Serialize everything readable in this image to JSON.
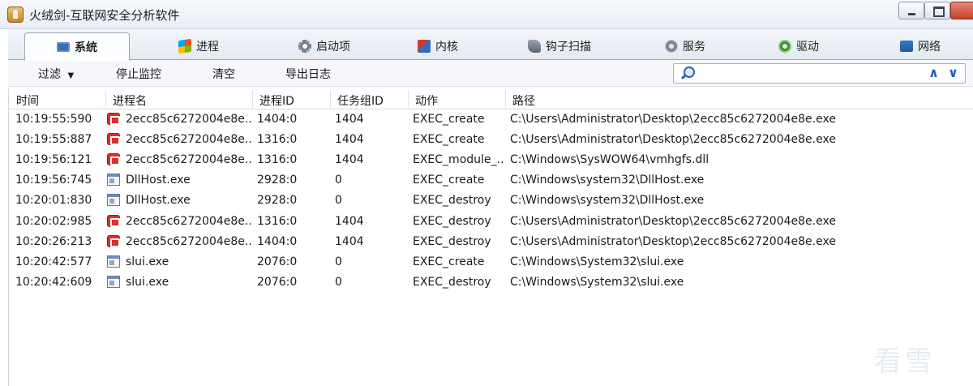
{
  "window": {
    "title": "火绒剑-互联网安全分析软件"
  },
  "tabs": [
    {
      "label": "系统",
      "icon": "monitor-icon",
      "active": true
    },
    {
      "label": "进程",
      "icon": "windows-icon",
      "active": false
    },
    {
      "label": "启动项",
      "icon": "gear-icon",
      "active": false
    },
    {
      "label": "内核",
      "icon": "kernel-icon",
      "active": false
    },
    {
      "label": "钩子扫描",
      "icon": "hook-icon",
      "active": false
    },
    {
      "label": "服务",
      "icon": "service-icon",
      "active": false
    },
    {
      "label": "驱动",
      "icon": "driver-icon",
      "active": false
    },
    {
      "label": "网络",
      "icon": "network-icon",
      "active": false
    }
  ],
  "toolbar": {
    "filter_label": "过滤",
    "stop_label": "停止监控",
    "clear_label": "清空",
    "export_label": "导出日志",
    "search_value": "",
    "up_arrow": "∧",
    "down_arrow": "∨"
  },
  "table": {
    "columns": [
      "时间",
      "进程名",
      "进程ID",
      "任务组ID",
      "动作",
      "路径"
    ],
    "rows": [
      {
        "time": "10:19:55:590",
        "icon": "red-exe-icon",
        "process": "2ecc85c6272004e8e....",
        "pid": "1404:0",
        "group": "1404",
        "action": "EXEC_create",
        "path": "C:\\Users\\Administrator\\Desktop\\2ecc85c6272004e8e.exe"
      },
      {
        "time": "10:19:55:887",
        "icon": "red-exe-icon",
        "process": "2ecc85c6272004e8e....",
        "pid": "1316:0",
        "group": "1404",
        "action": "EXEC_create",
        "path": "C:\\Users\\Administrator\\Desktop\\2ecc85c6272004e8e.exe"
      },
      {
        "time": "10:19:56:121",
        "icon": "red-exe-icon",
        "process": "2ecc85c6272004e8e....",
        "pid": "1316:0",
        "group": "1404",
        "action": "EXEC_module_...",
        "path": "C:\\Windows\\SysWOW64\\vmhgfs.dll"
      },
      {
        "time": "10:19:56:745",
        "icon": "window-exe-icon",
        "process": "DllHost.exe",
        "pid": "2928:0",
        "group": "0",
        "action": "EXEC_create",
        "path": "C:\\Windows\\system32\\DllHost.exe"
      },
      {
        "time": "10:20:01:830",
        "icon": "window-exe-icon",
        "process": "DllHost.exe",
        "pid": "2928:0",
        "group": "0",
        "action": "EXEC_destroy",
        "path": "C:\\Windows\\system32\\DllHost.exe"
      },
      {
        "time": "10:20:02:985",
        "icon": "red-exe-icon",
        "process": "2ecc85c6272004e8e....",
        "pid": "1316:0",
        "group": "1404",
        "action": "EXEC_destroy",
        "path": "C:\\Users\\Administrator\\Desktop\\2ecc85c6272004e8e.exe"
      },
      {
        "time": "10:20:26:213",
        "icon": "red-exe-icon",
        "process": "2ecc85c6272004e8e....",
        "pid": "1404:0",
        "group": "1404",
        "action": "EXEC_destroy",
        "path": "C:\\Users\\Administrator\\Desktop\\2ecc85c6272004e8e.exe"
      },
      {
        "time": "10:20:42:577",
        "icon": "window-exe-icon",
        "process": "slui.exe",
        "pid": "2076:0",
        "group": "0",
        "action": "EXEC_create",
        "path": "C:\\Windows\\System32\\slui.exe"
      },
      {
        "time": "10:20:42:609",
        "icon": "window-exe-icon",
        "process": "slui.exe",
        "pid": "2076:0",
        "group": "0",
        "action": "EXEC_destroy",
        "path": "C:\\Windows\\System32\\slui.exe"
      }
    ]
  },
  "watermark": {
    "text": "看雪"
  }
}
